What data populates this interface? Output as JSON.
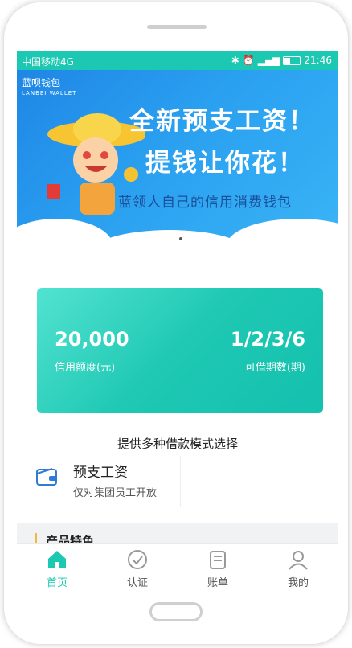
{
  "statusbar": {
    "carrier": "中国移动4G",
    "time": "21:46"
  },
  "banner": {
    "logo_text": "蓝呗钱包",
    "logo_sub": "LANBEI WALLET",
    "headline_1": "全新预支工资！",
    "headline_2": "提钱让你花！",
    "slogan": "蓝领人自己的信用消费钱包"
  },
  "credit_card": {
    "amount": "20,000",
    "amount_label": "信用额度(元)",
    "periods": "1/2/3/6",
    "periods_label": "可借期数(期)"
  },
  "modes": {
    "title": "提供多种借款模式选择",
    "items": [
      {
        "title": "预支工资",
        "desc": "仅对集团员工开放"
      }
    ]
  },
  "features": {
    "label": "产品特色"
  },
  "tabs": [
    {
      "label": "首页",
      "icon": "home-icon",
      "active": true
    },
    {
      "label": "认证",
      "icon": "check-circle-icon",
      "active": false
    },
    {
      "label": "账单",
      "icon": "bill-icon",
      "active": false
    },
    {
      "label": "我的",
      "icon": "user-icon",
      "active": false
    }
  ],
  "colors": {
    "accent": "#1cc8b1",
    "banner_blue": "#2aa0f0",
    "feature_bar": "#f6b73c"
  }
}
